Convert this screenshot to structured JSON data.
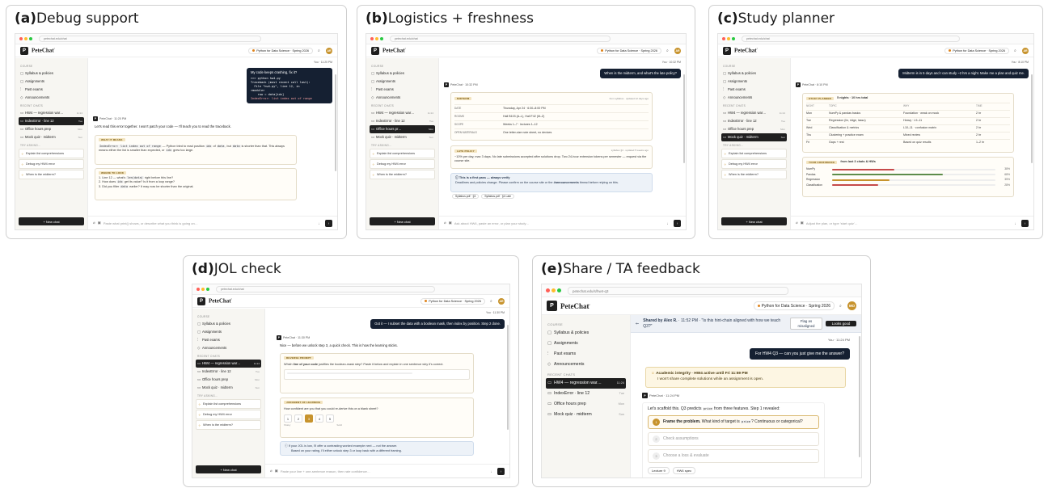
{
  "panels": {
    "a": {
      "label": "(a)",
      "title": "Debug support"
    },
    "b": {
      "label": "(b)",
      "title": "Logistics + freshness"
    },
    "c": {
      "label": "(c)",
      "title": "Study planner"
    },
    "d": {
      "label": "(d)",
      "title": "JOL check"
    },
    "e": {
      "label": "(e)",
      "title": "Share / TA feedback"
    }
  },
  "app": {
    "brand": "PeteChat",
    "brand_sup": "β",
    "url": "petechat.edu/chat",
    "url_share": "petechat.edu/s/hw4-q3",
    "course": "Python for Data Science · Spring 2026",
    "avatar": "AR",
    "avatar_e": "MO",
    "new_chat": "+ New chat",
    "logo": "P"
  },
  "sidebar": {
    "course_h": "COURSE",
    "course_items": [
      "Syllabus & policies",
      "Assignments",
      "Past exams",
      "Announcements"
    ],
    "recent_h": "RECENT CHATS",
    "recent_items": [
      {
        "label": "HW4 — regression war…",
        "time": "11:24"
      },
      {
        "label": "IndexError · line 12",
        "time": "Tue"
      },
      {
        "label": "Office hours prep",
        "time": "Mon"
      },
      {
        "label": "Mock quiz · midterm",
        "time": "Sun"
      }
    ],
    "try_h": "TRY ASKING…",
    "try_items": [
      "Explain list comprehensions",
      "Debug my HW4 error",
      "When is the midterm?"
    ],
    "office_short": "Office hours pr…"
  },
  "a": {
    "you": "You · 11:20 PM",
    "user_line": "My code keeps crashing, fix it?",
    "user_code": [
      ">>> python hw4.py",
      "Traceback (most recent call last):",
      "  File \"hw4.py\", line 12, in",
      "<module>",
      "    row = data[idx]"
    ],
    "user_err": "IndexError: list index out of range",
    "bot": "PeteChat · 11:20 PM",
    "bot_line": "Let's read this error together. I won't patch your code — I'll teach you to read the traceback.",
    "card1_tag": "WHAT IT MEANS",
    "card1_code": "IndexError: list index out of range",
    "card1_p1": " — Python tried to read position ",
    "card1_c2": "idx",
    "card1_p2": " of ",
    "card1_c3": "data",
    "card1_p3": ", but ",
    "card1_c4": "data",
    "card1_p4": " is shorter than that. This always means either the list is smaller than expected, or ",
    "card1_c5": "idx",
    "card1_p5": " grew too large.",
    "card2_tag": "WHERE TO LOOK",
    "card2_l1a": "1. Line 12 — what's ",
    "card2_l1c": "len(data)",
    "card2_l1b": " right before this line?",
    "card2_l2a": "2. How does ",
    "card2_l2c": "idx",
    "card2_l2b": " get its value? Is it from a loop range?",
    "card2_l3a": "3. Did you filter ",
    "card2_l3c": "data",
    "card2_l3b": " earlier? It may now be shorter than the original.",
    "compose": "Paste what print() shows, or describe what you think is going on…"
  },
  "b": {
    "you": "You · 10:32 PM",
    "user_line": "When is the midterm, and what's the late policy?",
    "bot": "PeteChat · 10:32 PM",
    "mid_tag": "MIDTERM",
    "mid_src": "from syllabus · updated 12 days ago",
    "mid_rows": [
      {
        "k": "DATE",
        "v": "Thursday, Apr 24 · 6:30–8:00 PM"
      },
      {
        "k": "ROOMS",
        "v": "Hall B103 (A–L), Hall F42 (M–Z)"
      },
      {
        "k": "SCOPE",
        "v": "Weeks 1–7 · lectures 1–12"
      },
      {
        "k": "OPEN MATERIALS",
        "v": "One letter-size note sheet, no devices"
      }
    ],
    "late_tag": "LATE POLICY",
    "late_src": "syllabus §4 · updated 5 weeks ago",
    "late_text": "−10% per day, max 3 days. No late submissions accepted after solutions drop. Two 24-hour extension tokens per semester — request via the course site.",
    "info_h": "This is a first pass — always verify",
    "info_t1": "Deadlines and policies change. Please confirm on the course site or the ",
    "info_b": "#announcements",
    "info_t2": " thread before relying on this.",
    "chips": [
      "Syllabus.pdf · §3",
      "Syllabus.pdf · §4 Late"
    ],
    "compose": "Ask about HW4, paste an error, or plan your study…"
  },
  "c": {
    "you": "You · 8:10 PM",
    "user_line": "Midterm is in 5 days and I can study ~2 hrs a night. Make me a plan and quiz me.",
    "bot": "PeteChat · 8:10 PM",
    "plan_tag": "STUDY PLANNER",
    "plan_head": "5 nights · 10 hrs total",
    "cols": [
      "NIGHT",
      "TOPIC",
      "WHY",
      "TIME"
    ],
    "rows": [
      [
        "Mon",
        "NumPy & pandas basics",
        "Foundation · weak on mock",
        "2 hr"
      ],
      [
        "Tue",
        "Regression (lin, ridge, lasso)",
        "Heavy · L9–11",
        "2 hr"
      ],
      [
        "Wed",
        "Classification & metrics",
        "L10–11 · confusion matrix",
        "2 hr"
      ],
      [
        "Thu",
        "Clustering + practice exam",
        "Mixed review",
        "2 hr"
      ],
      [
        "Fri",
        "Gaps + rest",
        "Based on quiz results",
        "1–2 hr"
      ]
    ],
    "conf_tag": "YOUR CONFIDENCE",
    "conf_head": "from last 3 chats & HWs",
    "conf": [
      {
        "name": "NumPy",
        "pct": "38%",
        "v": 0.38,
        "color": "#c64a4a"
      },
      {
        "name": "Pandas",
        "pct": "68%",
        "v": 0.68,
        "color": "#5d8c4a"
      },
      {
        "name": "Regression",
        "pct": "35%",
        "v": 0.35,
        "color": "#c7932d"
      },
      {
        "name": "Classification",
        "pct": "28%",
        "v": 0.28,
        "color": "#c64a4a"
      }
    ],
    "compose": "Adjust the plan, or type 'start quiz'…"
  },
  "d": {
    "you": "You · 11:30 PM",
    "user_line": "Got it — I subset the data with a boolean mask, then index by position. Step 2 done.",
    "bot": "PeteChat · 11:30 PM",
    "bot_line": "Nice — before we unlock step 3, a quick check. This is how the learning sticks.",
    "card1_tag": "REVERSE PROMPT",
    "card1_t1": "Which ",
    "card1_b": "line of your code",
    "card1_t2": " justifies the boolean-mask step? Paste it below and explain in one sentence why it's correct.",
    "card2_tag": "JUDGMENT OF LEARNING",
    "card2_q": "How confident are you that you could re-derive this on a blank sheet?",
    "ratings": [
      "1",
      "2",
      "3",
      "4",
      "5"
    ],
    "rating_lo": "Shaky",
    "rating_hi": "Solid",
    "info_t1": "If your JOL is low, I'll offer a contrasting worked example next — not the answer.",
    "info_t2": "Based on your rating, I'll either unlock step 3 or loop back with a different framing.",
    "compose": "Paste your line + one-sentence reason, then rate confidence…"
  },
  "e": {
    "share_by": "Shared by Alex R.",
    "share_time": " · 11:52 PM · ",
    "share_q": "\"Is this hint-chain aligned with how we teach Q3?\"",
    "flag_btn": "Flag as misaligned",
    "good_btn": "Looks good",
    "you": "You · 11:24 PM",
    "user_line": "For HW4 Q3 — can you just give me the answer?",
    "ai_h": "Academic integrity · HW4 active until Fri 11:59 PM",
    "ai_t": "I won't share complete solutions while an assignment is open.",
    "bot": "PeteChat · 11:24 PM",
    "bot_t1": "Let's scaffold this. Q3 predicts ",
    "bot_c": "price",
    "bot_t2": " from three features. Step 1 revealed:",
    "steps": [
      {
        "n": "1",
        "b": "Frame the problem.",
        "t1": " What kind of target is ",
        "c": "price",
        "t2": "? Continuous or categorical?"
      },
      {
        "n": "2",
        "t": "Check assumptions"
      },
      {
        "n": "3",
        "t": "Choose a loss & evaluate"
      }
    ],
    "chips": [
      "Lecture 9",
      "HW4 spec"
    ]
  }
}
